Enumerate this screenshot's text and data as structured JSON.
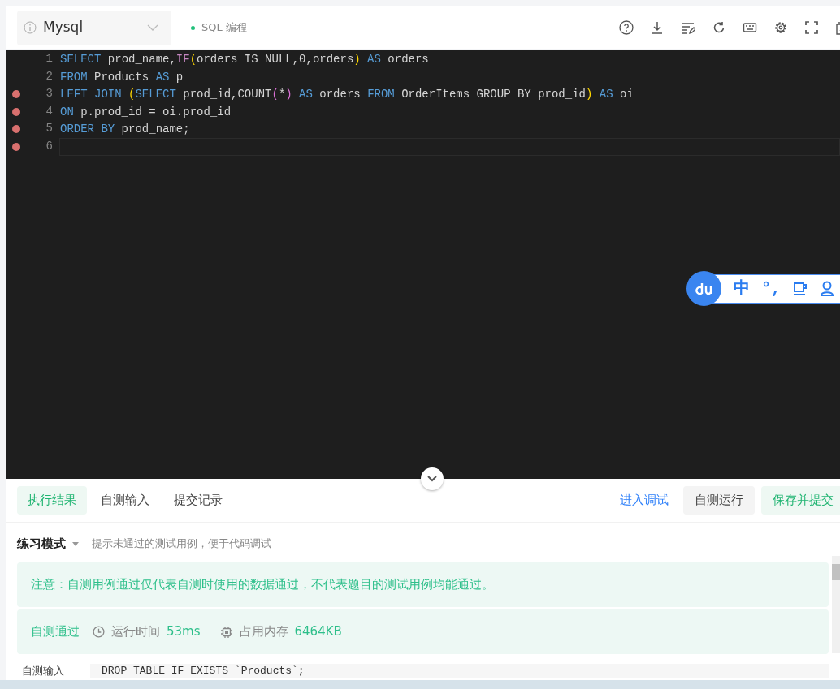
{
  "header": {
    "language": "Mysql",
    "mode_label": "SQL 编程"
  },
  "editor": {
    "lines": [
      {
        "number": "1",
        "breakpoint": false,
        "active": false,
        "tokens": [
          {
            "kind": "kw",
            "text": "SELECT"
          },
          {
            "kind": "plain",
            "text": " prod_name,"
          },
          {
            "kind": "fn",
            "text": "IF"
          },
          {
            "kind": "paren",
            "text": "("
          },
          {
            "kind": "plain",
            "text": "orders IS NULL,0,orders"
          },
          {
            "kind": "paren",
            "text": ")"
          },
          {
            "kind": "kw",
            "text": " AS"
          },
          {
            "kind": "plain",
            "text": " orders"
          }
        ]
      },
      {
        "number": "2",
        "breakpoint": false,
        "active": false,
        "tokens": [
          {
            "kind": "kw",
            "text": "FROM"
          },
          {
            "kind": "plain",
            "text": " Products "
          },
          {
            "kind": "kw",
            "text": "AS"
          },
          {
            "kind": "plain",
            "text": " p"
          }
        ]
      },
      {
        "number": "3",
        "breakpoint": true,
        "active": false,
        "tokens": [
          {
            "kind": "kw",
            "text": "LEFT JOIN "
          },
          {
            "kind": "paren",
            "text": "("
          },
          {
            "kind": "kw",
            "text": "SELECT"
          },
          {
            "kind": "plain",
            "text": " prod_id,COUNT"
          },
          {
            "kind": "paren2",
            "text": "("
          },
          {
            "kind": "plain",
            "text": "*"
          },
          {
            "kind": "paren2",
            "text": ")"
          },
          {
            "kind": "kw",
            "text": " AS"
          },
          {
            "kind": "plain",
            "text": " orders "
          },
          {
            "kind": "kw",
            "text": "FROM"
          },
          {
            "kind": "plain",
            "text": " OrderItems GROUP BY prod_id"
          },
          {
            "kind": "paren",
            "text": ")"
          },
          {
            "kind": "kw",
            "text": " AS"
          },
          {
            "kind": "plain",
            "text": " oi"
          }
        ]
      },
      {
        "number": "4",
        "breakpoint": true,
        "active": false,
        "tokens": [
          {
            "kind": "kw",
            "text": "ON"
          },
          {
            "kind": "plain",
            "text": " p.prod_id = oi.prod_id"
          }
        ]
      },
      {
        "number": "5",
        "breakpoint": true,
        "active": false,
        "tokens": [
          {
            "kind": "kw",
            "text": "ORDER BY"
          },
          {
            "kind": "plain",
            "text": " prod_name;"
          }
        ]
      },
      {
        "number": "6",
        "breakpoint": true,
        "active": true
      }
    ]
  },
  "ime_toolbar": {
    "items": [
      "中",
      "°,"
    ]
  },
  "tabs": [
    {
      "label": "执行结果",
      "selected": true
    },
    {
      "label": "自测输入",
      "selected": false
    },
    {
      "label": "提交记录",
      "selected": false
    }
  ],
  "actions": [
    {
      "kind": "link",
      "label": "进入调试"
    },
    {
      "kind": "secondary",
      "label": "自测运行"
    },
    {
      "kind": "primary",
      "label": "保存并提交"
    }
  ],
  "mode": {
    "label": "练习模式",
    "hint": "提示未通过的测试用例，便于代码调试"
  },
  "notice": "注意：自测用例通过仅代表自测时使用的数据通过，不代表题目的测试用例均能通过。",
  "result": {
    "status": "自测通过",
    "time_label": "运行时间",
    "time": "53ms",
    "memory_label": "占用内存",
    "memory": "6464KB"
  },
  "input_row": {
    "label": "自测输入",
    "value": "DROP TABLE IF EXISTS `Products`;"
  }
}
